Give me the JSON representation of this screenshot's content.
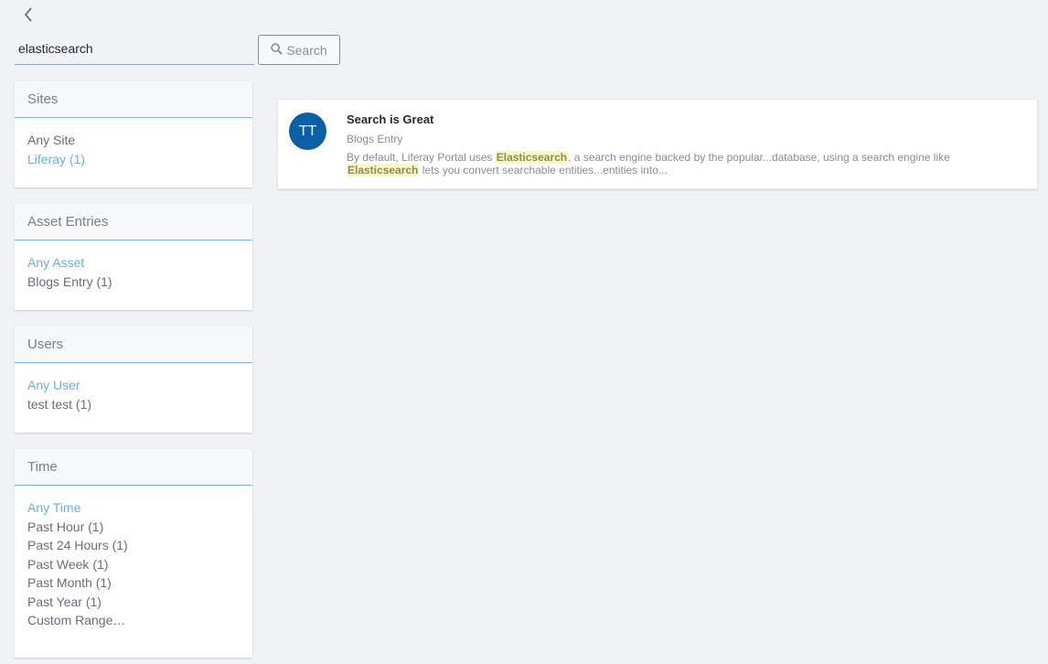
{
  "search": {
    "query": "elasticsearch",
    "button_label": "Search"
  },
  "facets": {
    "sites": {
      "title": "Sites",
      "terms": [
        {
          "label": "Any Site",
          "active": false
        },
        {
          "label": "Liferay (1)",
          "active": true
        }
      ]
    },
    "asset_entries": {
      "title": "Asset Entries",
      "terms": [
        {
          "label": "Any Asset",
          "active": true
        },
        {
          "label": "Blogs Entry (1)",
          "active": false
        }
      ]
    },
    "users": {
      "title": "Users",
      "terms": [
        {
          "label": "Any User",
          "active": true
        },
        {
          "label": "test test (1)",
          "active": false
        }
      ]
    },
    "time": {
      "title": "Time",
      "terms": [
        {
          "label": "Any Time",
          "active": true
        },
        {
          "label": "Past Hour (1)",
          "active": false
        },
        {
          "label": "Past 24 Hours (1)",
          "active": false
        },
        {
          "label": "Past Week (1)",
          "active": false
        },
        {
          "label": "Past Month (1)",
          "active": false
        },
        {
          "label": "Past Year (1)",
          "active": false
        },
        {
          "label": "Custom Range…",
          "active": false
        }
      ]
    }
  },
  "results": [
    {
      "avatar_initials": "TT",
      "avatar_color": "#0b5fa5",
      "title": "Search is Great",
      "type": "Blogs Entry",
      "snippet_parts": [
        {
          "text": "By default, Liferay Portal uses ",
          "highlight": false
        },
        {
          "text": "Elasticsearch",
          "highlight": true
        },
        {
          "text": ", a search engine backed by the popular...database, using a search engine like ",
          "highlight": false
        },
        {
          "text": "Elasticsearch",
          "highlight": true
        },
        {
          "text": " lets you convert searchable entities...entities into...",
          "highlight": false
        }
      ]
    }
  ],
  "icons": {
    "back": "chevron-left-icon",
    "search": "search-icon"
  },
  "colors": {
    "active_link": "#65b2de",
    "avatar": "#0b5fa5",
    "highlight_bg": "#fcf6c3",
    "facet_divider": "#7ab3de"
  }
}
